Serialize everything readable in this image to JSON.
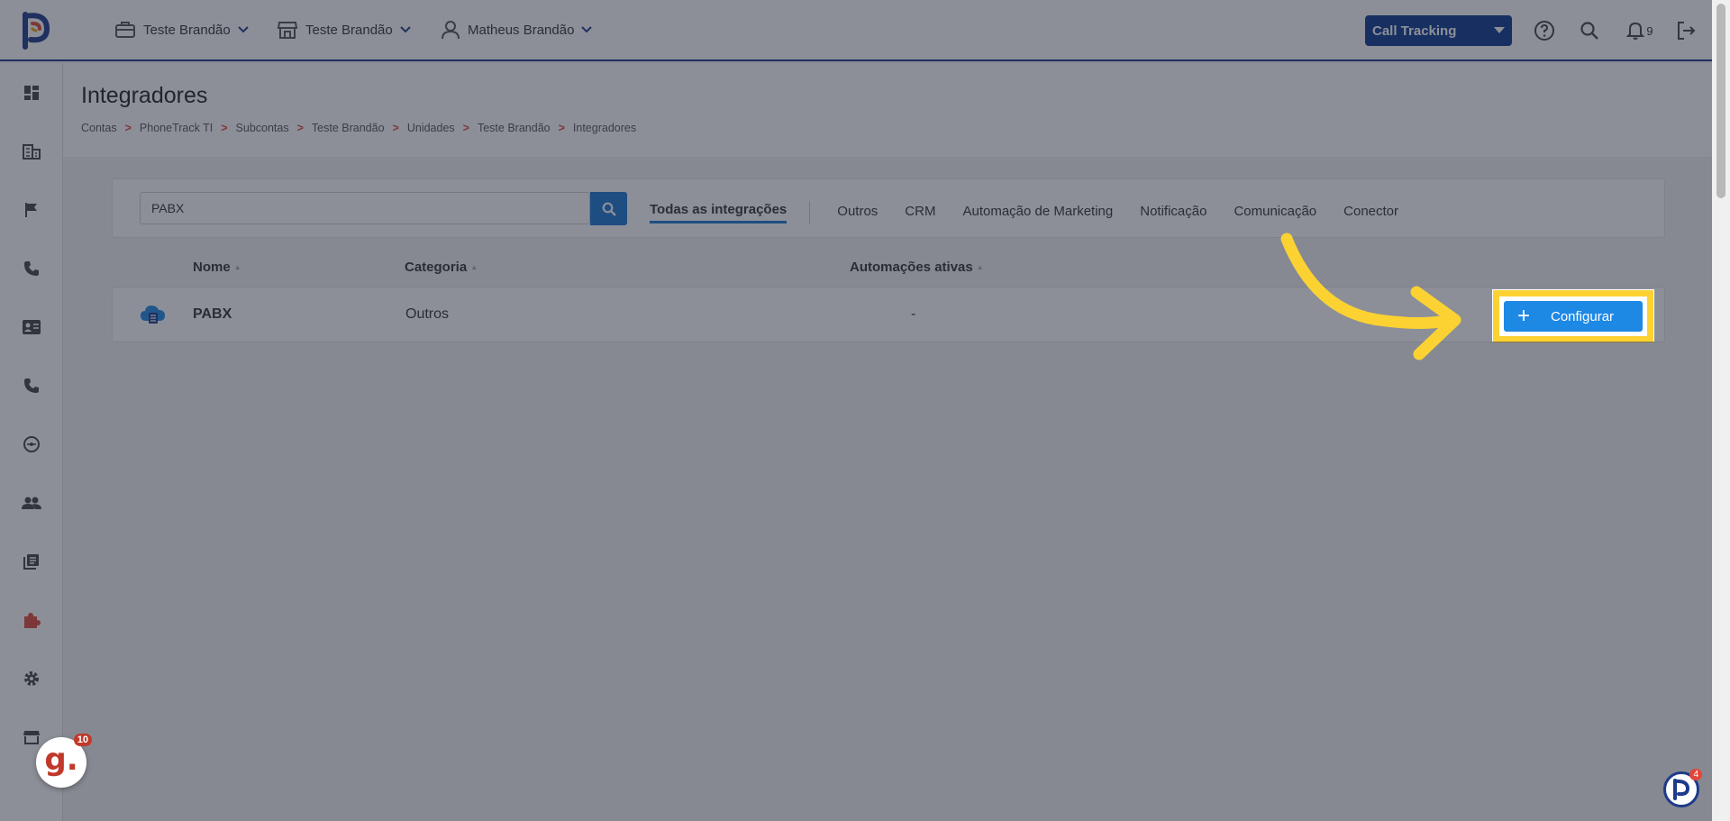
{
  "topbar": {
    "account_label": "Teste Brandão",
    "store_label": "Teste Brandão",
    "user_label": "Matheus Brandão",
    "product_select": "Call Tracking",
    "notifications_count": "9"
  },
  "header": {
    "title": "Integradores",
    "breadcrumb": [
      "Contas",
      "PhoneTrack TI",
      "Subcontas",
      "Teste Brandão",
      "Unidades",
      "Teste Brandão",
      "Integradores"
    ],
    "separator": ">"
  },
  "filters": {
    "search_value": "PABX",
    "tabs": [
      "Todas as integrações",
      "Outros",
      "CRM",
      "Automação de Marketing",
      "Notificação",
      "Comunicação",
      "Conector"
    ]
  },
  "table": {
    "columns": [
      "Nome",
      "Categoria",
      "Automações ativas"
    ],
    "rows": [
      {
        "name": "PABX",
        "category": "Outros",
        "active_automations": "-"
      }
    ],
    "configure_label": "Configurar",
    "configure_icon": "+"
  },
  "widgets": {
    "g_letter": "g.",
    "g_count": "10",
    "chat_count": "4"
  },
  "colors": {
    "brand_blue": "#0b3a8f",
    "primary_button": "#1e88e5",
    "highlight": "#fbd232",
    "active_sidebar": "#e0473a"
  }
}
